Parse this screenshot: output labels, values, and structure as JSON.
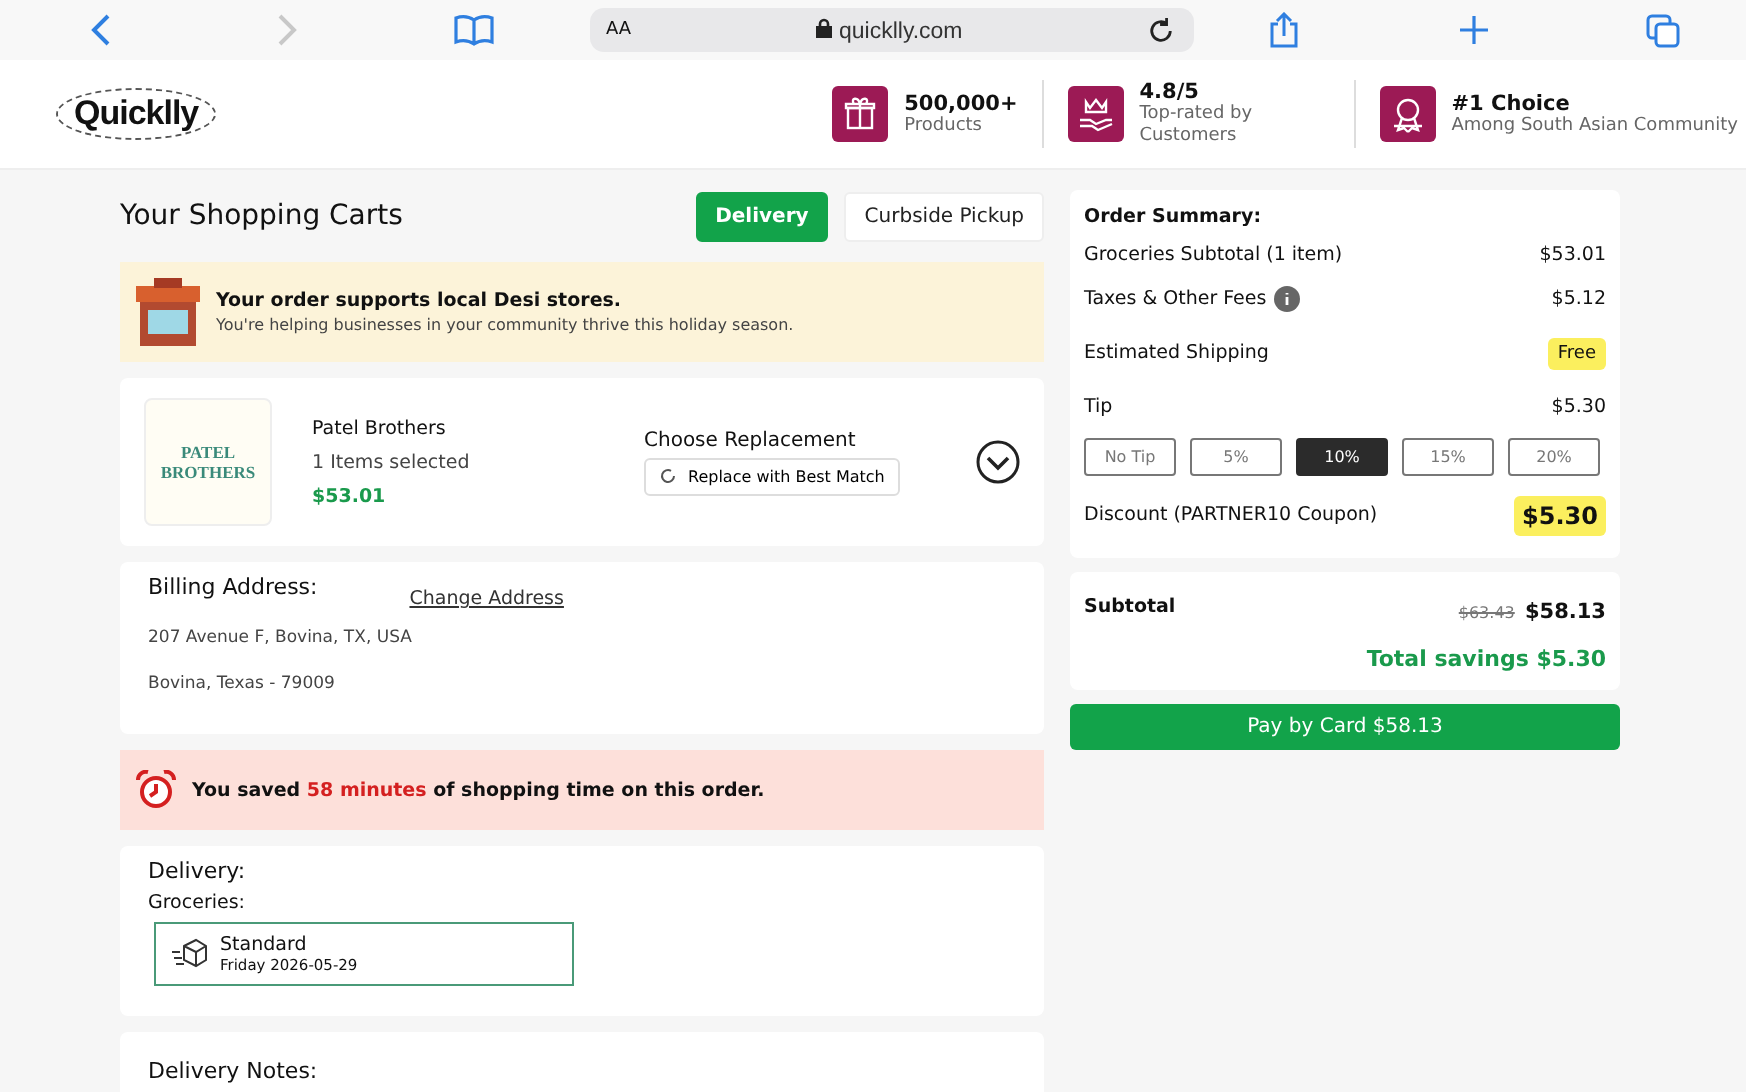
{
  "browser": {
    "text_size": "AA",
    "url": "quicklly.com"
  },
  "header": {
    "logo": "Quicklly",
    "badges": [
      {
        "kind": "gift",
        "title": "500,000+",
        "subtitle": "Products"
      },
      {
        "kind": "hand",
        "title": "4.8/5",
        "subtitle": "Top-rated by Customers"
      },
      {
        "kind": "medal",
        "title": "#1 Choice",
        "subtitle": "Among South Asian Community"
      }
    ]
  },
  "cart": {
    "title": "Your Shopping Carts",
    "tabs": [
      {
        "label": "Delivery",
        "selected": true
      },
      {
        "label": "Curbside Pickup",
        "selected": false
      }
    ]
  },
  "banner": {
    "title": "Your order supports local Desi stores.",
    "text": "You're helping businesses in your community thrive this holiday season."
  },
  "store": {
    "logo_text": "PATEL BROTHERS",
    "name": "Patel Brothers",
    "items": "1 Items selected",
    "price": "$53.01",
    "replacement_label": "Choose Replacement",
    "replacement": "Replace with Best Match",
    "expanded": false
  },
  "billing": {
    "title": "Billing Address:",
    "change": "Change Address",
    "line1": "207 Avenue F, Bovina, TX, USA",
    "line2": "Bovina, Texas - 79009"
  },
  "saved": {
    "before": "You saved ",
    "highlight": "58 minutes",
    "after": " of shopping time on this order."
  },
  "delivery": {
    "title": "Delivery:",
    "group": "Groceries:",
    "option": {
      "name": "Standard",
      "date": "Friday 2026-05-29",
      "selected": true
    }
  },
  "notes": {
    "title": "Delivery Notes:"
  },
  "summary": {
    "title": "Order Summary:",
    "rows": [
      {
        "kind": "plain",
        "label": "Groceries Subtotal (1 item)",
        "value": "$53.01"
      },
      {
        "kind": "info",
        "label": "Taxes & Other Fees",
        "value": "$5.12"
      },
      {
        "kind": "tag",
        "label": "Estimated Shipping",
        "value": "Free"
      },
      {
        "kind": "plain",
        "label": "Tip",
        "value": "$5.30"
      }
    ],
    "tips": [
      {
        "label": "No Tip",
        "selected": false
      },
      {
        "label": "5%",
        "selected": false
      },
      {
        "label": "10%",
        "selected": true
      },
      {
        "label": "15%",
        "selected": false
      },
      {
        "label": "20%",
        "selected": false
      }
    ],
    "discount": {
      "label": "Discount (PARTNER10 Coupon)",
      "value": "$5.30"
    }
  },
  "totals": {
    "label": "Subtotal",
    "old": "$63.43",
    "value": "$58.13",
    "savings": "Total savings $5.30"
  },
  "pay": "Pay by Card $58.13"
}
